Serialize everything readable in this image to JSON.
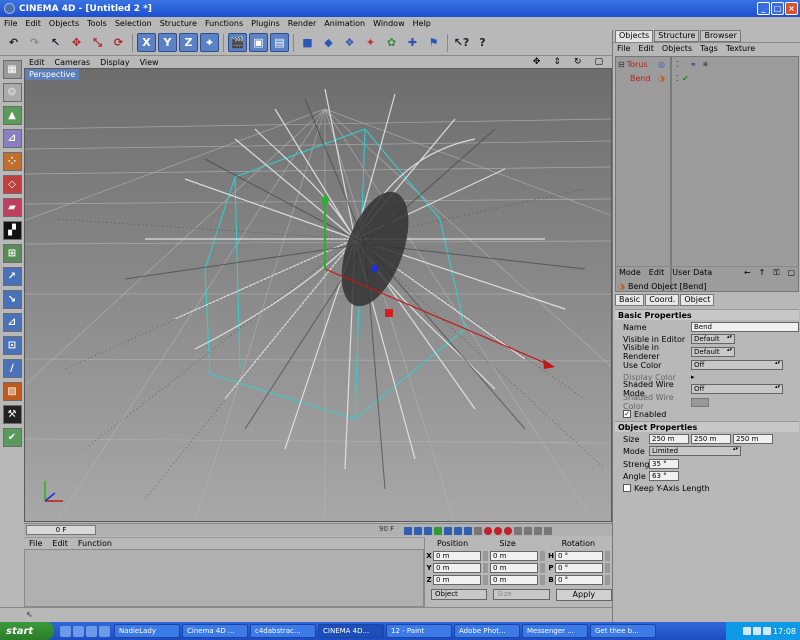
{
  "window": {
    "title": "CINEMA 4D - [Untitled 2 *]"
  },
  "menu": [
    "File",
    "Edit",
    "Objects",
    "Tools",
    "Selection",
    "Structure",
    "Functions",
    "Plugins",
    "Render",
    "Animation",
    "Window",
    "Help"
  ],
  "viewport": {
    "menu": [
      "Edit",
      "Cameras",
      "Display",
      "View"
    ],
    "label": "Perspective",
    "nav_icons": [
      "move-view-icon",
      "zoom-view-icon",
      "rotate-view-icon",
      "maximize-view-icon"
    ]
  },
  "timeline": {
    "current_frame": "0 F",
    "end_frame": "90 F"
  },
  "materials": {
    "menu": [
      "File",
      "Edit",
      "Function"
    ]
  },
  "coords": {
    "headers": [
      "Position",
      "Size",
      "Rotation"
    ],
    "rows": [
      {
        "axis": "X",
        "pos": "0 m",
        "size": "0 m",
        "rot_axis": "H",
        "rot": "0 °"
      },
      {
        "axis": "Y",
        "pos": "0 m",
        "size": "0 m",
        "rot_axis": "P",
        "rot": "0 °"
      },
      {
        "axis": "Z",
        "pos": "0 m",
        "size": "0 m",
        "rot_axis": "B",
        "rot": "0 °"
      }
    ],
    "mode": "Object",
    "size_mode": "Size",
    "apply": "Apply"
  },
  "objects": {
    "tabs": [
      "Objects",
      "Structure",
      "Browser"
    ],
    "menu": [
      "File",
      "Edit",
      "Objects",
      "Tags",
      "Texture"
    ],
    "items": [
      {
        "name": "Torus"
      },
      {
        "name": "Bend"
      }
    ]
  },
  "attributes": {
    "menu": [
      "Mode",
      "Edit",
      "User Data"
    ],
    "title": "Bend Object [Bend]",
    "tabs": [
      "Basic",
      "Coord.",
      "Object"
    ],
    "basic_header": "Basic Properties",
    "name_label": "Name",
    "name_value": "Bend",
    "vis_editor_label": "Visible in Editor",
    "vis_editor_value": "Default",
    "vis_render_label": "Visible in Renderer",
    "vis_render_value": "Default",
    "use_color_label": "Use Color",
    "use_color_value": "Off",
    "display_color_label": "Display Color",
    "shaded_mode_label": "Shaded Wire Mode",
    "shaded_mode_value": "Off",
    "shaded_color_label": "Shaded Wire Color",
    "enabled_label": "Enabled",
    "object_header": "Object Properties",
    "size_label": "Size",
    "size_values": [
      "250 m",
      "250 m",
      "250 m"
    ],
    "mode_label": "Mode",
    "mode_value": "Limited",
    "strength_label": "Strength",
    "strength_value": "35 °",
    "angle_label": "Angle",
    "angle_value": "63 °",
    "keep_label": "Keep Y-Axis Length"
  },
  "taskbar": {
    "start": "start",
    "tasks": [
      "NadieLady",
      "Cinema 4D ...",
      "c4dabstrac...",
      "CINEMA 4D...",
      "12 - Paint",
      "Adobe Phot...",
      "Messenger ...",
      "Get thee b..."
    ],
    "clock": "17:08"
  }
}
